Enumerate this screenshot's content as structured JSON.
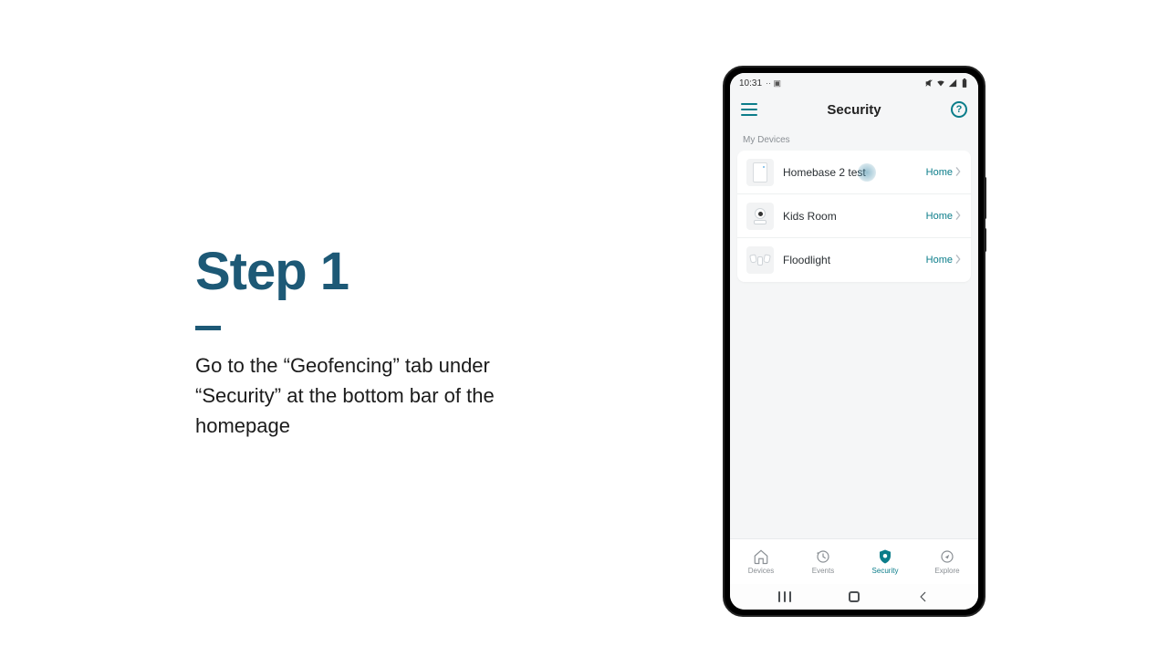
{
  "instruction": {
    "title": "Step 1",
    "body": "Go to the “Geofencing” tab under “Security” at the bottom bar of the homepage"
  },
  "status_bar": {
    "time": "10:31",
    "left_extra": "·· ▣"
  },
  "app": {
    "header_title": "Security",
    "section_label": "My Devices",
    "devices": [
      {
        "name": "Homebase 2 test",
        "status": "Home"
      },
      {
        "name": "Kids Room",
        "status": "Home"
      },
      {
        "name": "Floodlight",
        "status": "Home"
      }
    ],
    "tabs": [
      {
        "label": "Devices"
      },
      {
        "label": "Events"
      },
      {
        "label": "Security"
      },
      {
        "label": "Explore"
      }
    ],
    "active_tab_index": 2
  }
}
